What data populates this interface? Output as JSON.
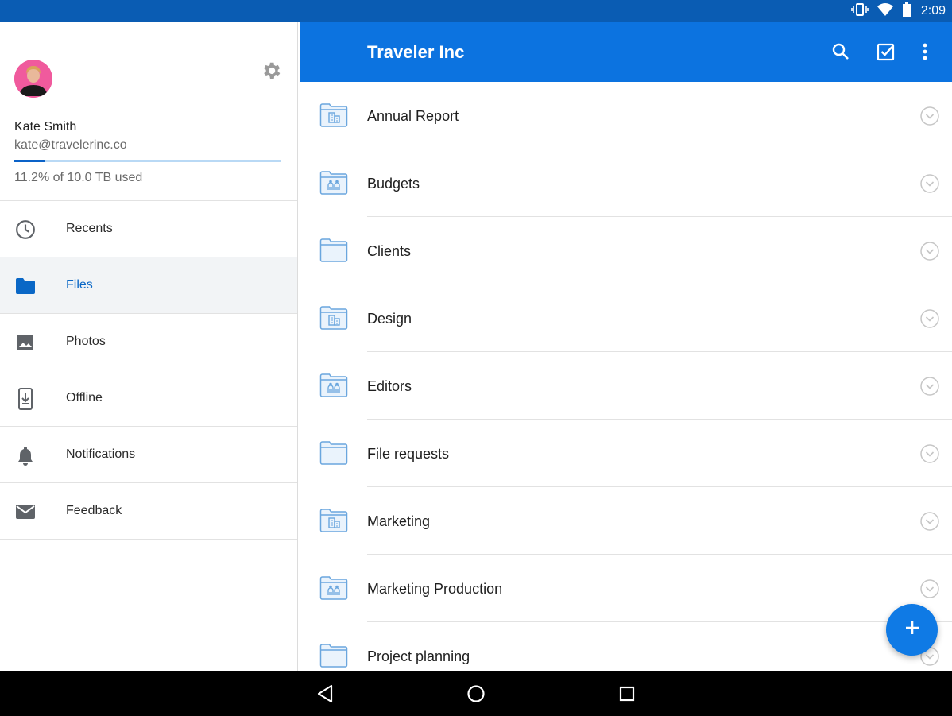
{
  "status_bar": {
    "time": "2:09"
  },
  "sidebar": {
    "user": {
      "name": "Kate Smith",
      "email": "kate@travelerinc.co"
    },
    "quota": {
      "text": "11.2% of 10.0 TB used",
      "fraction": 0.112
    },
    "items": [
      {
        "label": "Recents",
        "icon": "clock-icon",
        "active": false
      },
      {
        "label": "Files",
        "icon": "folder-icon",
        "active": true
      },
      {
        "label": "Photos",
        "icon": "photo-icon",
        "active": false
      },
      {
        "label": "Offline",
        "icon": "offline-icon",
        "active": false
      },
      {
        "label": "Notifications",
        "icon": "bell-icon",
        "active": false
      },
      {
        "label": "Feedback",
        "icon": "mail-icon",
        "active": false
      }
    ]
  },
  "header": {
    "title": "Traveler Inc"
  },
  "files": [
    {
      "name": "Annual Report",
      "icon": "team-folder-icon"
    },
    {
      "name": "Budgets",
      "icon": "shared-folder-icon"
    },
    {
      "name": "Clients",
      "icon": "folder-icon"
    },
    {
      "name": "Design",
      "icon": "team-folder-icon"
    },
    {
      "name": "Editors",
      "icon": "shared-folder-icon"
    },
    {
      "name": "File requests",
      "icon": "folder-icon"
    },
    {
      "name": "Marketing",
      "icon": "team-folder-icon"
    },
    {
      "name": "Marketing Production",
      "icon": "shared-folder-icon"
    },
    {
      "name": "Project planning",
      "icon": "folder-icon"
    }
  ],
  "colors": {
    "accent": "#0c73e0",
    "status_bar": "#0a5cb3",
    "active_text": "#0a67c6",
    "folder": "#6aa6de"
  }
}
